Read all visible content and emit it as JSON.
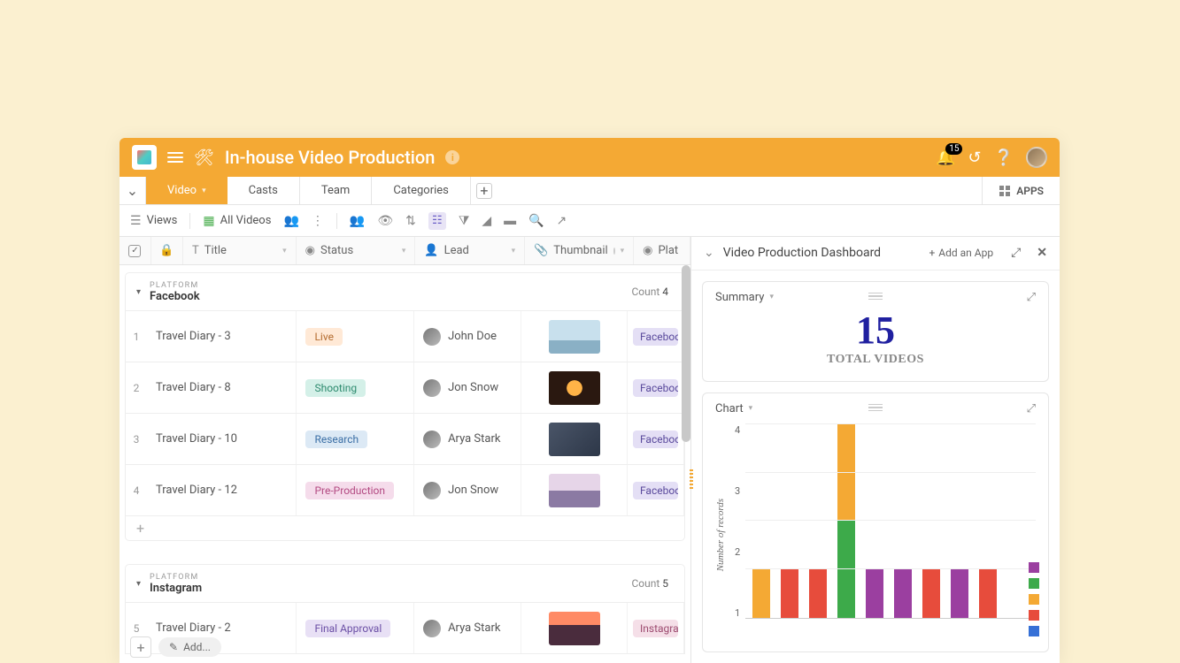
{
  "titlebar": {
    "app_title": "In-house Video Production",
    "notification_count": "15"
  },
  "tabs": {
    "items": [
      "Video",
      "Casts",
      "Team",
      "Categories"
    ],
    "apps_label": "APPS"
  },
  "toolbar": {
    "views": "Views",
    "all_videos": "All Videos"
  },
  "columns": {
    "title": "Title",
    "status": "Status",
    "lead": "Lead",
    "thumbnail": "Thumbnail",
    "platform": "Plat"
  },
  "groups": [
    {
      "label": "PLATFORM",
      "name": "Facebook",
      "count_label": "Count",
      "count": "4",
      "rows": [
        {
          "idx": "1",
          "title": "Travel Diary - 3",
          "status": "Live",
          "status_cls": "st-live",
          "lead": "John Doe",
          "thumb": "t1",
          "platform": "Faceboo",
          "plat_cls": ""
        },
        {
          "idx": "2",
          "title": "Travel Diary - 8",
          "status": "Shooting",
          "status_cls": "st-shoot",
          "lead": "Jon Snow",
          "thumb": "t2",
          "platform": "Faceboo",
          "plat_cls": ""
        },
        {
          "idx": "3",
          "title": "Travel Diary - 10",
          "status": "Research",
          "status_cls": "st-research",
          "lead": "Arya Stark",
          "thumb": "t3",
          "platform": "Faceboo",
          "plat_cls": ""
        },
        {
          "idx": "4",
          "title": "Travel Diary - 12",
          "status": "Pre-Production",
          "status_cls": "st-pre",
          "lead": "Jon Snow",
          "thumb": "t4",
          "platform": "Faceboo",
          "plat_cls": ""
        }
      ]
    },
    {
      "label": "PLATFORM",
      "name": "Instagram",
      "count_label": "Count",
      "count": "5",
      "rows": [
        {
          "idx": "5",
          "title": "Travel Diary - 2",
          "status": "Final Approval",
          "status_cls": "st-final",
          "lead": "Arya Stark",
          "thumb": "t5",
          "platform": "Instagra",
          "plat_cls": "ig"
        }
      ]
    }
  ],
  "footer": {
    "add_label": "Add..."
  },
  "sidebar": {
    "title": "Video Production Dashboard",
    "add_app": "Add an App",
    "summary": {
      "title": "Summary",
      "value": "15",
      "label": "TOTAL VIDEOS"
    },
    "chart": {
      "title": "Chart"
    }
  },
  "chart_data": {
    "type": "bar-stacked",
    "ylabel": "Number of records",
    "ylim": [
      0,
      4
    ],
    "yticks": [
      "4",
      "3",
      "2",
      "1"
    ],
    "colors": {
      "orange": "#f4a934",
      "red": "#e74c3c",
      "purple": "#9b3fa0",
      "green": "#3daa4a",
      "blue": "#3670d6"
    },
    "legend": [
      "purple",
      "green",
      "orange",
      "red",
      "blue"
    ],
    "bars": [
      [
        {
          "c": "orange",
          "v": 1
        }
      ],
      [
        {
          "c": "red",
          "v": 1
        }
      ],
      [
        {
          "c": "red",
          "v": 1
        }
      ],
      [
        {
          "c": "green",
          "v": 2
        },
        {
          "c": "orange",
          "v": 2
        }
      ],
      [
        {
          "c": "purple",
          "v": 1
        }
      ],
      [
        {
          "c": "purple",
          "v": 1
        }
      ],
      [
        {
          "c": "red",
          "v": 1
        }
      ],
      [
        {
          "c": "purple",
          "v": 1
        }
      ],
      [
        {
          "c": "red",
          "v": 1
        }
      ]
    ]
  }
}
